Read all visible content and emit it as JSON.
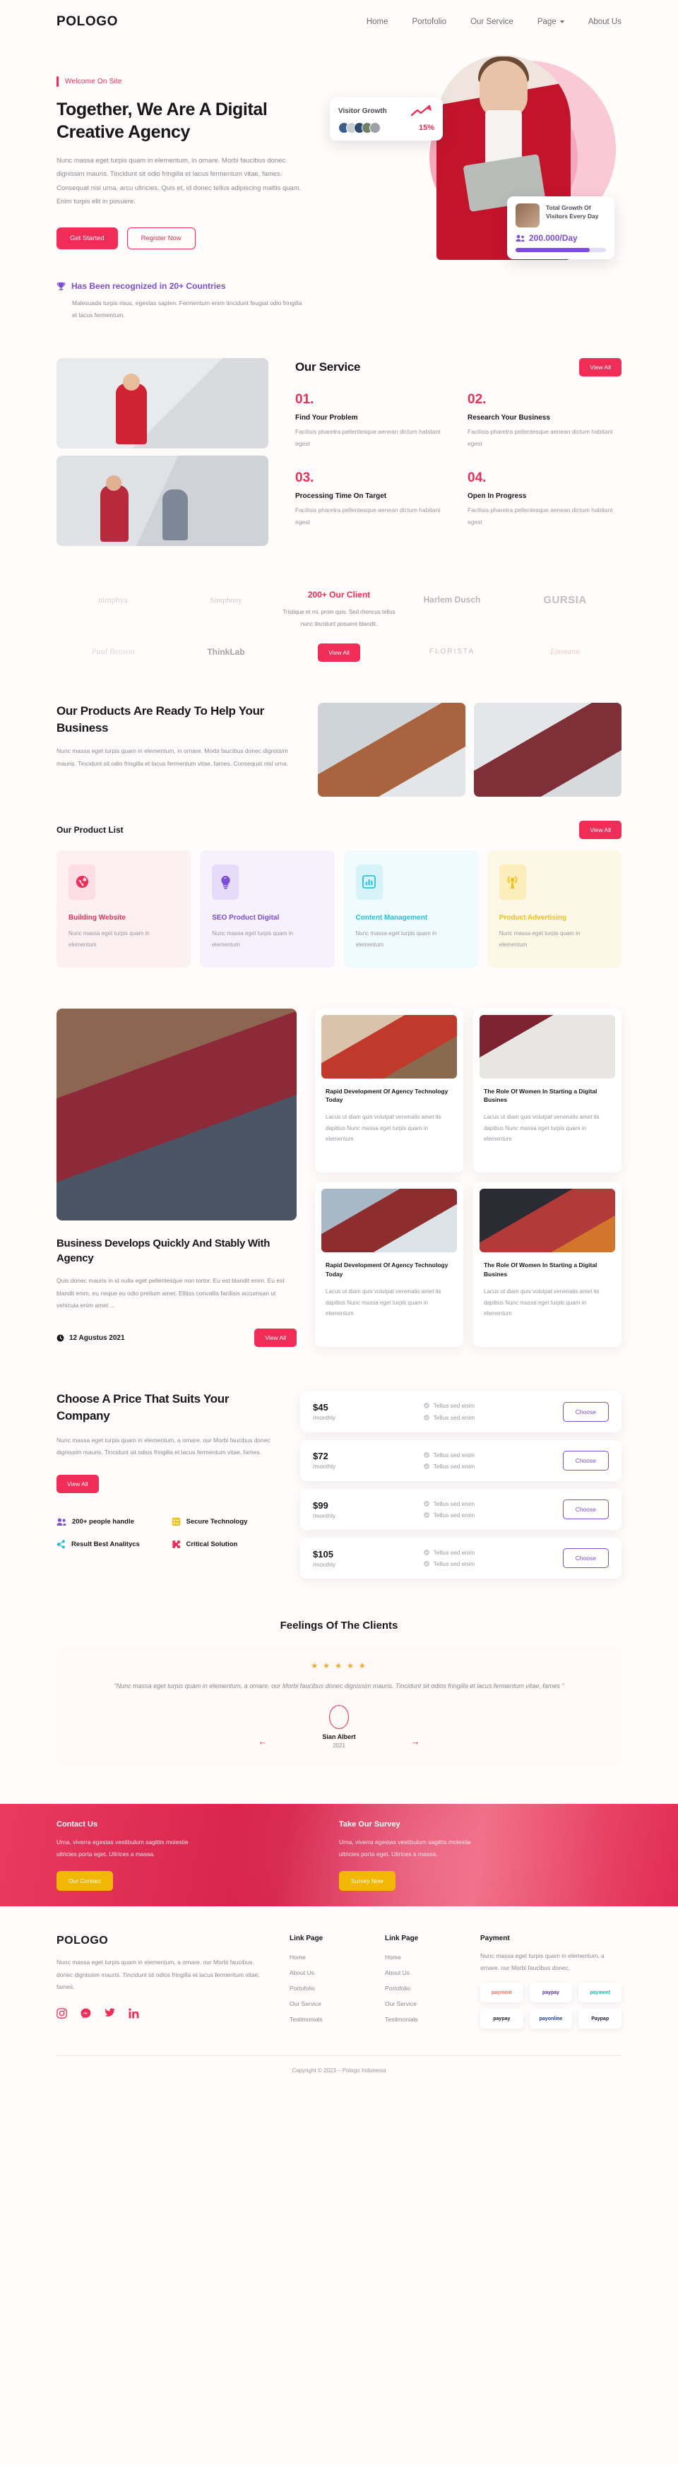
{
  "brand": "POLOGO",
  "nav": {
    "links": [
      {
        "label": "Home"
      },
      {
        "label": "Portofolio"
      },
      {
        "label": "Our Service"
      },
      {
        "label": "Page",
        "has_caret": true
      },
      {
        "label": "About Us"
      }
    ]
  },
  "hero": {
    "eyebrow": "Welcome On Site",
    "title": "Together, We Are A Digital Creative Agency",
    "desc": "Nunc massa eget turpis quam in elementum, in ornare. Morbi faucibus donec dignissim mauris. Tincidunt sit odio fringilla et lacus fermentum vitae, fames. Consequat nisi urna, arcu ultricies. Quis et, id donec tellus adipiscing mattis quam. Enim turpis elit in posuere.",
    "btn_primary": "Get Started",
    "btn_outline": "Register Now",
    "card_visitor": {
      "title": "Visitor Growth",
      "percent": "15%"
    },
    "card_total": {
      "title": "Total Growth Of Visitors Every Day",
      "value": "200.000/Day",
      "progress": 82
    }
  },
  "recognized": {
    "title": "Has Been recognized in 20+ Countries",
    "desc": "Malesuada turpis risus, egestas sapien. Fermentum enim tincidunt feugiat odio fringilla et lacus fermentum."
  },
  "service": {
    "title": "Our Service",
    "view_all": "View All",
    "items": [
      {
        "num": "01.",
        "name": "Find Your Problem",
        "text": "Facilisis pharetra pellentesque aenean dictum habitant egest"
      },
      {
        "num": "02.",
        "name": "Research Your Business",
        "text": "Facilisis pharetra pellentesque aenean dictum habitant egest"
      },
      {
        "num": "03.",
        "name": "Processing Time On Target",
        "text": "Facilisis pharetra pellentesque aenean dictum habitant egest"
      },
      {
        "num": "04.",
        "name": "Open In Progress",
        "text": "Facilisis pharetra pellentesque aenean dictum habitant egest"
      }
    ]
  },
  "clients": {
    "heading": "200+  Our Client",
    "desc": "Tristique et mi, proin quis. Sed rhoncus tellus nunc tincidunt posuere blandit.",
    "view_all": "View All",
    "logos": [
      {
        "name": "nimphya"
      },
      {
        "name": "Simphony"
      },
      {
        "name": "Harlem Dusch"
      },
      {
        "name": "GURSIA"
      },
      {
        "name": "Paul Benson"
      },
      {
        "name": "ThinkLab"
      },
      {
        "name": "FLORISTA"
      },
      {
        "name": "Eismann"
      }
    ]
  },
  "products": {
    "title": "Our Products Are Ready To Help Your Business",
    "desc": "Nunc massa eget turpis quam in elementum, in ornare. Morbi faucibus donec dignissim mauris. Tincidunt sit odio fringilla et lacus fermentum vitae, fames. Consequat nisl urna.",
    "list_title": "Our Product List",
    "view_all": "View All",
    "cards": [
      {
        "name": "Building Website",
        "text": "Nunc massa eget turpis quam in elementum",
        "color": "#ef2d56",
        "bg": "#fdf0f2",
        "icon_bg": "#fbdde3",
        "icon": "globe-icon"
      },
      {
        "name": "SEO Product Digital",
        "text": "Nunc massa eget turpis quam in elementum",
        "color": "#7c4dd6",
        "bg": "#f6f2fd",
        "icon_bg": "#e6dcfa",
        "icon": "bulb-icon"
      },
      {
        "name": "Content Management",
        "text": "Nunc massa eget turpis quam in elementum",
        "color": "#22c0d8",
        "bg": "#effbfd",
        "icon_bg": "#d5f3f8",
        "icon": "chart-icon"
      },
      {
        "name": "Product Advertising",
        "text": "Nunc massa eget turpis quam in elementum",
        "color": "#f2c10d",
        "bg": "#fdf8e6",
        "icon_bg": "#fbeeba",
        "icon": "broadcast-icon"
      }
    ]
  },
  "blog": {
    "feature": {
      "title": "Business Develops Quickly And Stably With Agency",
      "desc": "Quis donec mauris in id nulla eget pellentesque non tortor. Eu est blandit enim. Eu est blandit enim, eu neque eu odio pretium amet. Elitiss convallis facilisis accumsan ut vehicula enim amet ...",
      "date": "12 Agustus 2021",
      "view_all": "View All"
    },
    "articles": [
      {
        "title": "Rapid Development Of Agency Technology Today",
        "text": "Lacus ut diam quis volutpat venenatis amet its dapibus Nunc massa eget turpis quam in elementum"
      },
      {
        "title": "The Role Of Women In Starting a Digital Busines",
        "text": "Lacus ut diam quis volutpat venenatis amet its dapibus Nunc massa eget turpis quam in elementum"
      },
      {
        "title": "Rapid Development Of Agency Technology Today",
        "text": "Lacus ut diam quis volutpat venenatis amet its dapibus Nunc massa eget turpis quam in elementum"
      },
      {
        "title": "The Role Of Women In Starting a Digital Busines",
        "text": "Lacus ut diam quis volutpat venenatis amet its dapibus Nunc massa eget turpis quam in elementum"
      }
    ]
  },
  "pricing": {
    "title": "Choose A Price That Suits Your Company",
    "desc": "Nunc massa eget turpis quam in elementum, a ornare. our Morbi faucibus donec dignissim mauris. Tincidunt sit odios fringilla et lacus fermentum vitae, fames.",
    "view_all": "View All",
    "features": [
      {
        "label": "200+ people handle",
        "icon": "people-icon",
        "color": "#7c4dd6"
      },
      {
        "label": "Secure Technology",
        "icon": "list-icon",
        "color": "#f2c10d"
      },
      {
        "label": "Result Best Analitycs",
        "icon": "share-icon",
        "color": "#22c0d8"
      },
      {
        "label": "Critical Solution",
        "icon": "puzzle-icon",
        "color": "#ef2d56"
      }
    ],
    "plans": [
      {
        "price": "$45",
        "period": "/monthly",
        "features": [
          "Tellus sed enim",
          "Tellus sed enim"
        ],
        "cta": "Choose"
      },
      {
        "price": "$72",
        "period": "/monthly",
        "features": [
          "Tellus sed enim",
          "Tellus sed enim"
        ],
        "cta": "Choose"
      },
      {
        "price": "$99",
        "period": "/monthly",
        "features": [
          "Tellus sed enim",
          "Tellus sed enim"
        ],
        "cta": "Choose"
      },
      {
        "price": "$105",
        "period": "/monthly",
        "features": [
          "Tellus sed enim",
          "Tellus sed enim"
        ],
        "cta": "Choose"
      }
    ]
  },
  "testimonial": {
    "heading": "Feelings Of The Clients",
    "stars": "★ ★ ★ ★ ★",
    "quote": "\"Nunc massa eget turpis quam in elementum, a ornare. our Morbi faucibus donec dignissim mauris. Tincidunt sit odios fringilla et lacus fermentum vitae, fames \"",
    "name": "Sian Albert",
    "year": "2021",
    "prev": "←",
    "next": "→"
  },
  "cta": {
    "columns": [
      {
        "title": "Contact Us",
        "text": "Urna, viverra egestas vestibulum sagittis molestie ultricies porta eget. Ultrices a massa.",
        "button": "Our Contact"
      },
      {
        "title": "Take Our Survey",
        "text": "Urna, viverra egestas vestibulum sagittis molestie ultricies porta eget. Ultrices a massa.",
        "button": "Survey Now"
      }
    ]
  },
  "footer": {
    "brand": "POLOGO",
    "desc": "Nunc massa eget turpis quam in elementum, a ornare. our Morbi faucibus donec dignissim mauris. Tincidunt sit odios fringilla et lacus fermentum vitae, fames.",
    "social": [
      "instagram-icon",
      "messenger-icon",
      "twitter-icon",
      "linkedin-icon"
    ],
    "columns": [
      {
        "title": "Link Page",
        "links": [
          "Home",
          "About Us",
          "Portofolio",
          "Our Service",
          "Testimonials"
        ]
      },
      {
        "title": "Link Page",
        "links": [
          "Home",
          "About Us",
          "Portofolio",
          "Our Service",
          "Testimonials"
        ]
      }
    ],
    "payment": {
      "title": "Payment",
      "desc": "Nunc massa eget turpis quam in elementum, a ornare. our Morbi faucibus donec.",
      "logos": [
        {
          "label": "payment",
          "color": "#f0715e"
        },
        {
          "label": "paypay",
          "color": "#5b2d9e"
        },
        {
          "label": "payment",
          "color": "#1bb8b0"
        },
        {
          "label": "paypay",
          "color": "#1a1a2e"
        },
        {
          "label": "payonline",
          "color": "#1b3a8c"
        },
        {
          "label": "Paypap",
          "color": "#1a1a2e"
        }
      ]
    },
    "copyright": "Copyright © 2023 – Pologo Indonesia"
  }
}
